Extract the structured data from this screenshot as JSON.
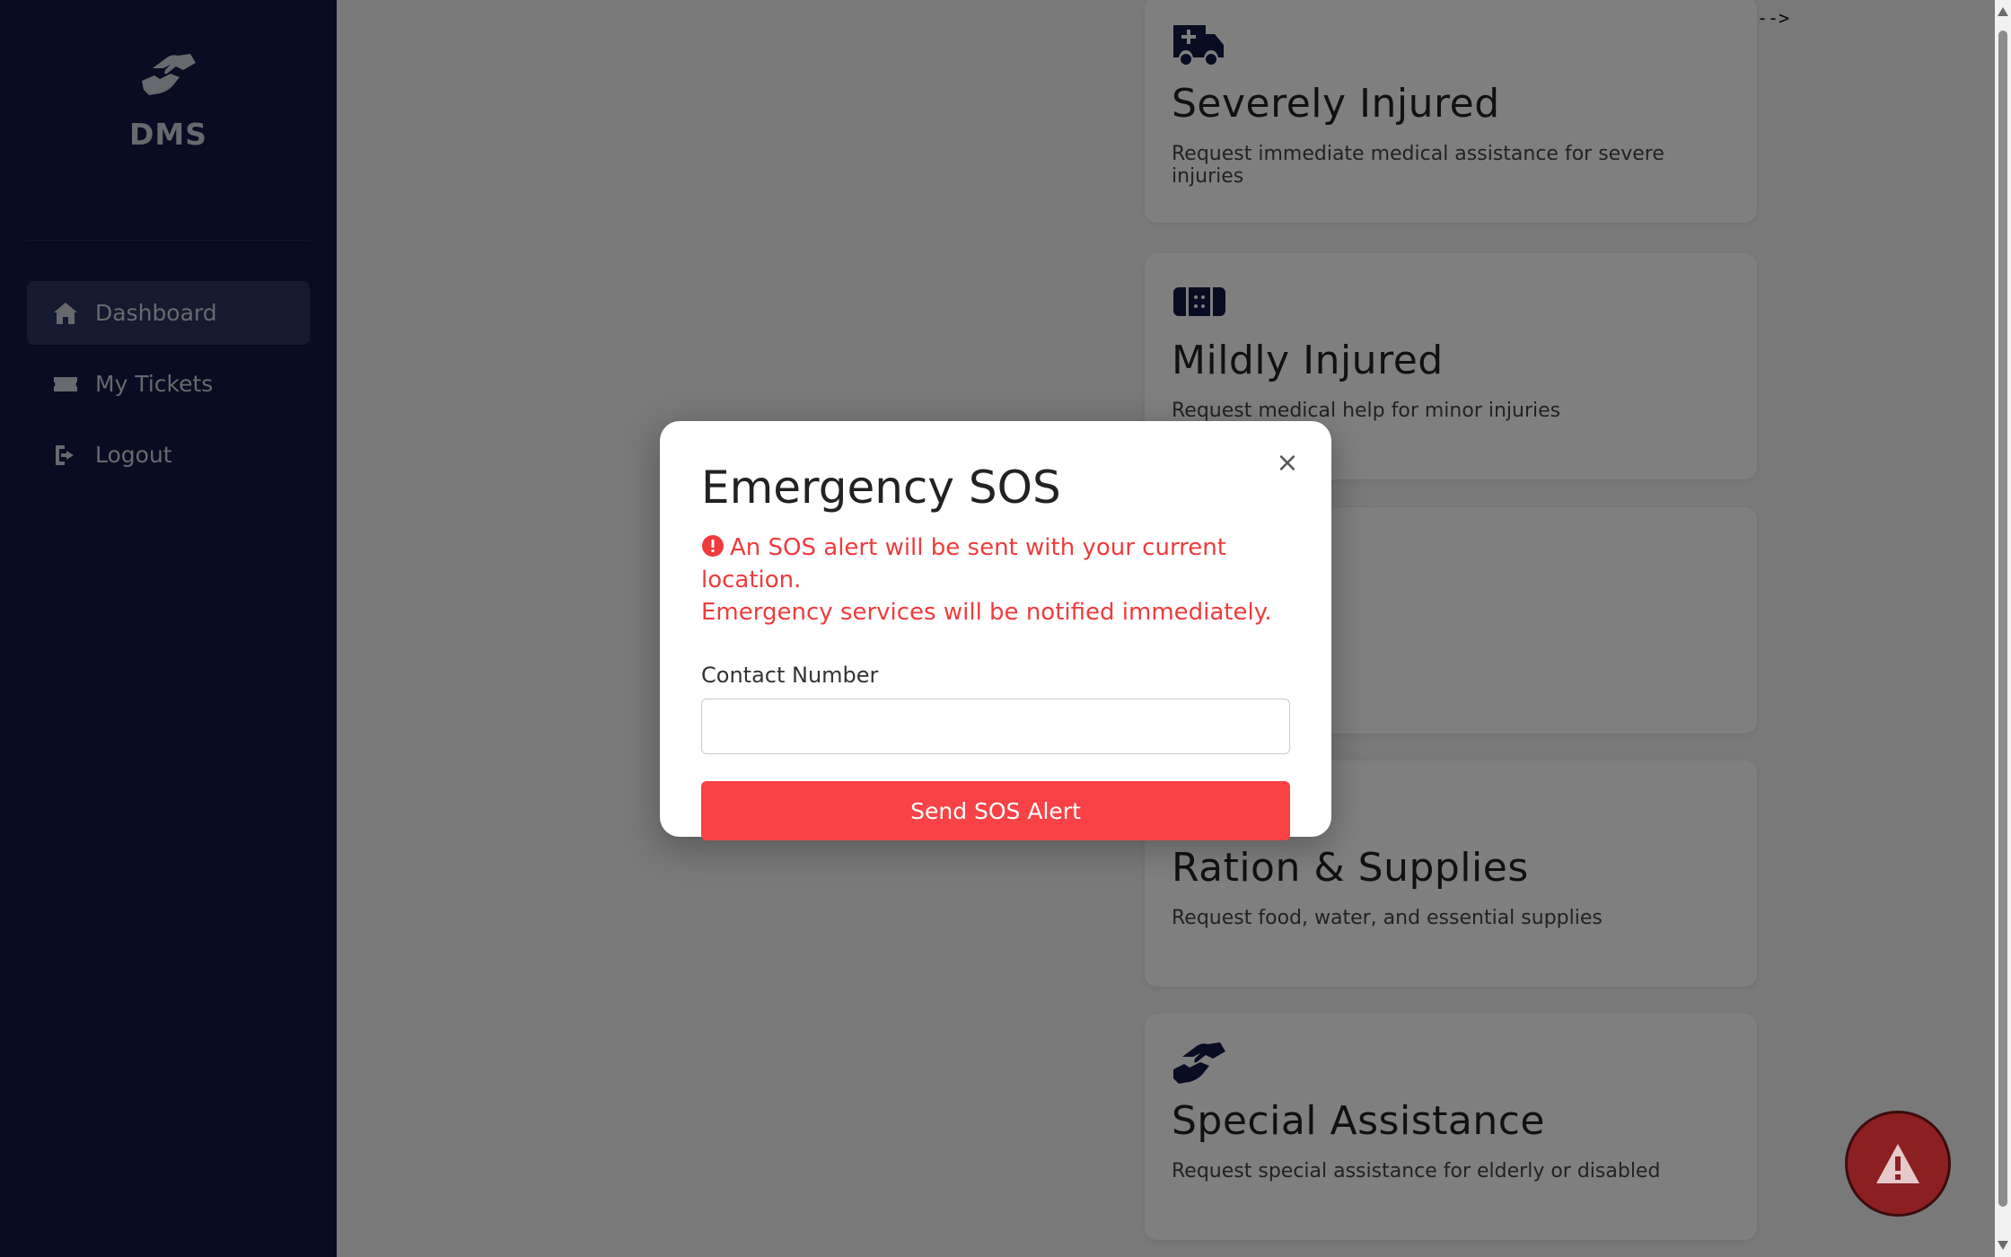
{
  "sidebar": {
    "brand": "DMS",
    "items": [
      {
        "label": "Dashboard",
        "icon": "home-icon"
      },
      {
        "label": "My Tickets",
        "icon": "ticket-icon"
      },
      {
        "label": "Logout",
        "icon": "logout-icon"
      }
    ]
  },
  "main": {
    "comment_text": "-->",
    "cards": [
      {
        "title": "Severely Injured",
        "description": "Request immediate medical assistance for severe injuries",
        "icon": "ambulance-icon"
      },
      {
        "title": "Mildly Injured",
        "description": "Request medical help for minor injuries",
        "icon": "bandage-icon"
      },
      {
        "title": "Ration & Supplies",
        "description": "Request food, water, and essential supplies",
        "icon": "supplies-icon"
      },
      {
        "title": "Special Assistance",
        "description": "Request special assistance for elderly or disabled",
        "icon": "handshake-icon"
      }
    ]
  },
  "modal": {
    "title": "Emergency SOS",
    "warning_line1": "An SOS alert will be sent with your current location.",
    "warning_line2": "Emergency services will be notified immediately.",
    "close_symbol": "×",
    "contact_label": "Contact Number",
    "contact_value": "",
    "submit_label": "Send SOS Alert"
  },
  "colors": {
    "sidebar_bg": "#121944",
    "accent_red": "#f84246",
    "sos_fab": "#8b1f21"
  }
}
